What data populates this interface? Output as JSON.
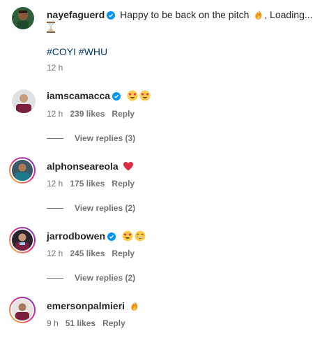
{
  "caption": {
    "username": "nayefaguerd",
    "text": "Happy to be back on the pitch",
    "text_suffix": ", Loading...",
    "hashtags": "#COYI #WHU",
    "time": "12 h"
  },
  "comments": [
    {
      "username": "iamscamacca",
      "verified": true,
      "time": "12 h",
      "likes": "239 likes",
      "reply": "Reply",
      "view_replies": "View replies (3)",
      "emojis": [
        "heart-eyes-emoji",
        "heart-eyes-emoji"
      ]
    },
    {
      "username": "alphonseareola",
      "verified": false,
      "time": "12 h",
      "likes": "175 likes",
      "reply": "Reply",
      "view_replies": "View replies (2)",
      "emojis": [
        "red-heart-emoji"
      ]
    },
    {
      "username": "jarrodbowen",
      "verified": true,
      "time": "12 h",
      "likes": "245 likes",
      "reply": "Reply",
      "view_replies": "View replies (2)",
      "emojis": [
        "heart-eyes-emoji",
        "grinning-emoji"
      ]
    },
    {
      "username": "emersonpalmieri",
      "verified": false,
      "time": "9 h",
      "likes": "51 likes",
      "reply": "Reply",
      "emojis": [
        "fire-emoji"
      ]
    }
  ],
  "colors": {
    "verified_blue": "#0095f6",
    "muted_text": "#737373",
    "hashtag_blue": "#00376b"
  }
}
